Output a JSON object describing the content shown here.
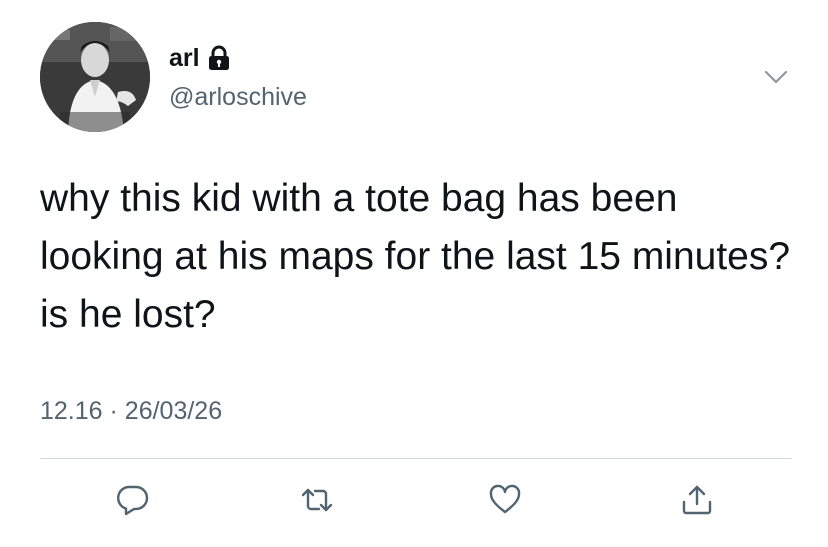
{
  "author": {
    "display_name": "arl",
    "handle": "@arloschive",
    "avatar_icon": "profile-photo",
    "protected_icon": "lock-icon"
  },
  "tweet": {
    "text": "why this kid with a tote bag has been looking at his maps for the last 15 minutes? is he lost?",
    "time": "12.16",
    "separator": "·",
    "date": "26/03/26"
  },
  "actions": {
    "reply_icon": "reply-icon",
    "retweet_icon": "retweet-icon",
    "like_icon": "like-icon",
    "share_icon": "share-icon",
    "menu_icon": "chevron-down-icon"
  },
  "colors": {
    "text": "#0f1419",
    "secondary": "#536471",
    "divider": "#cfd9de",
    "background": "#ffffff"
  }
}
